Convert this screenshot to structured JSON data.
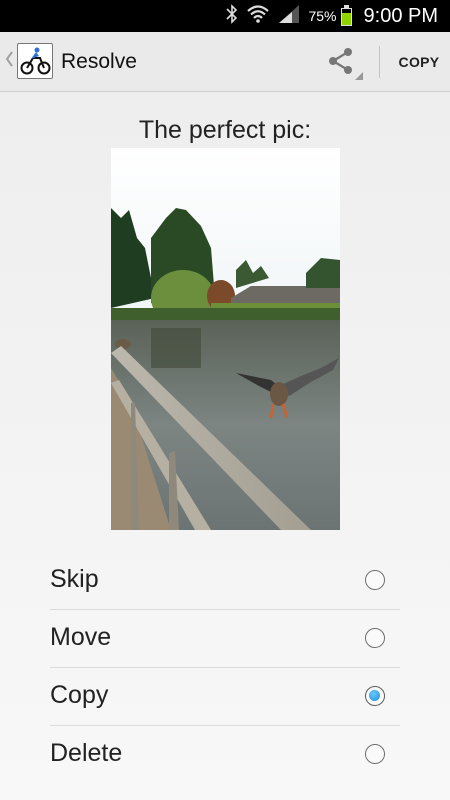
{
  "status_bar": {
    "battery_percent": "75%",
    "battery_level": 0.75,
    "time": "9:00 PM",
    "icons": [
      "bluetooth-icon",
      "wifi-icon",
      "signal-icon",
      "battery-icon"
    ]
  },
  "action_bar": {
    "title": "Resolve",
    "copy_label": "COPY",
    "icons": [
      "up-caret-icon",
      "app-icon",
      "share-icon"
    ]
  },
  "main": {
    "prompt": "The perfect pic:",
    "options": [
      {
        "label": "Skip",
        "selected": false
      },
      {
        "label": "Move",
        "selected": false
      },
      {
        "label": "Copy",
        "selected": true
      },
      {
        "label": "Delete",
        "selected": false
      }
    ]
  },
  "colors": {
    "status_bar_bg": "#000000",
    "action_bar_bg": "#eaeaea",
    "radio_selected": "#1a8fd6"
  }
}
